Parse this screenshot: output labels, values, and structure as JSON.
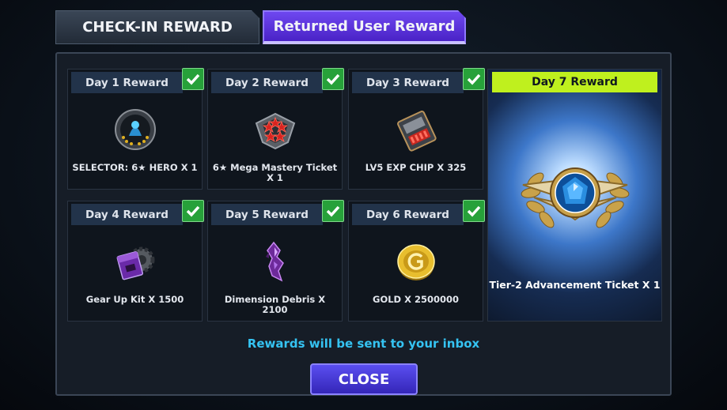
{
  "tabs": [
    {
      "label": "CHECK-IN REWARD"
    },
    {
      "label": "Returned User Reward"
    }
  ],
  "rewards": [
    {
      "day": "Day 1 Reward",
      "item": "SELECTOR: 6★ HERO X 1",
      "icon": "hero-selector-icon"
    },
    {
      "day": "Day 2 Reward",
      "item": "6★ Mega Mastery Ticket X 1",
      "icon": "mastery-ticket-icon"
    },
    {
      "day": "Day 3 Reward",
      "item": "LV5 EXP CHIP X 325",
      "icon": "exp-chip-icon"
    },
    {
      "day": "Day 4 Reward",
      "item": "Gear Up Kit X 1500",
      "icon": "gear-up-kit-icon"
    },
    {
      "day": "Day 5 Reward",
      "item": "Dimension Debris X 2100",
      "icon": "dimension-debris-icon"
    },
    {
      "day": "Day 6 Reward",
      "item": "GOLD X 2500000",
      "icon": "gold-coin-icon"
    }
  ],
  "day7": {
    "day": "Day 7 Reward",
    "item": "Tier-2 Advancement Ticket X 1",
    "icon": "advancement-ticket-icon"
  },
  "notice": "Rewards will be sent to your inbox",
  "close_label": "CLOSE",
  "colors": {
    "tab_active": "#5a35e0",
    "day7_header": "#bff01e",
    "check": "#27a13a",
    "notice": "#35c3f2"
  }
}
